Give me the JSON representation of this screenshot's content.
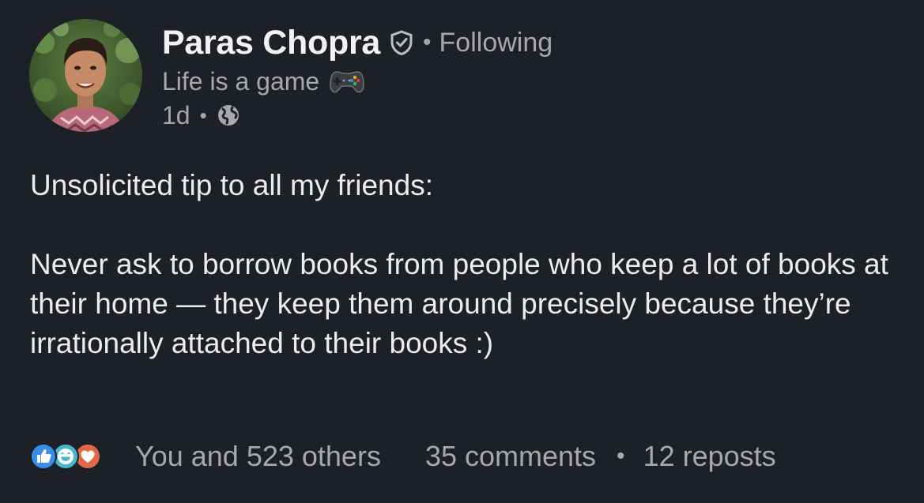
{
  "author": {
    "name": "Paras Chopra",
    "following_label": "Following",
    "headline": "Life is a game",
    "time": "1d",
    "separator": "•"
  },
  "post": {
    "paragraphs": [
      "Unsolicited tip to all my friends:",
      "Never ask to borrow books from people who keep a lot of books at their home — they keep them around precisely because they’re irrationally attached to their books :)"
    ]
  },
  "social": {
    "reactions_text": "You and 523 others",
    "comments_text": "35 comments",
    "reposts_text": "12 reposts",
    "reaction_icons": [
      "like-icon",
      "funny-icon",
      "love-icon"
    ]
  },
  "colors": {
    "background": "#1d2026",
    "like_blue": "#378fe9",
    "funny_teal": "#44b8c9",
    "love_orange": "#e06847"
  }
}
